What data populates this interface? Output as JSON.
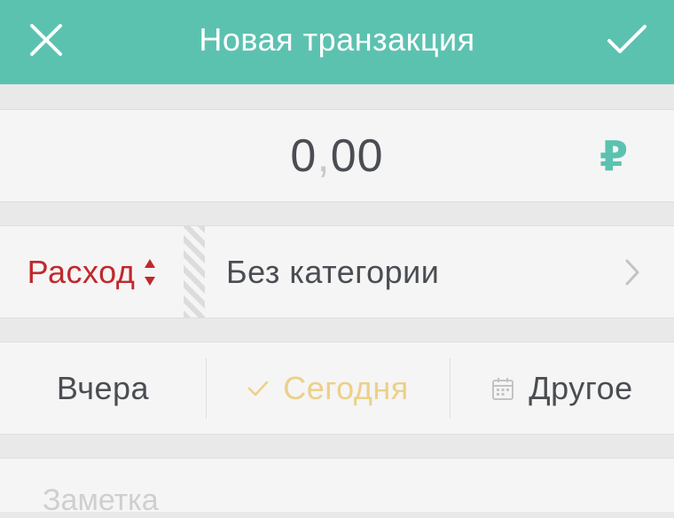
{
  "header": {
    "title": "Новая транзакция",
    "close_icon": "close-icon",
    "confirm_icon": "checkmark-icon",
    "background_color": "#5cc2b0"
  },
  "amount": {
    "integer": "0",
    "separator": ",",
    "fraction": "00",
    "currency_symbol": "₽",
    "currency_color": "#5cc2b0"
  },
  "transaction": {
    "type_label": "Расход",
    "type_color": "#c0282d",
    "type_icon": "sort-arrows-icon",
    "category_label": "Без категории",
    "category_icon": "chevron-right-icon"
  },
  "date": {
    "yesterday_label": "Вчера",
    "today_label": "Сегодня",
    "today_selected": true,
    "today_color": "#ecd08a",
    "other_label": "Другое",
    "other_icon": "calendar-icon"
  },
  "note": {
    "placeholder": "Заметка"
  }
}
